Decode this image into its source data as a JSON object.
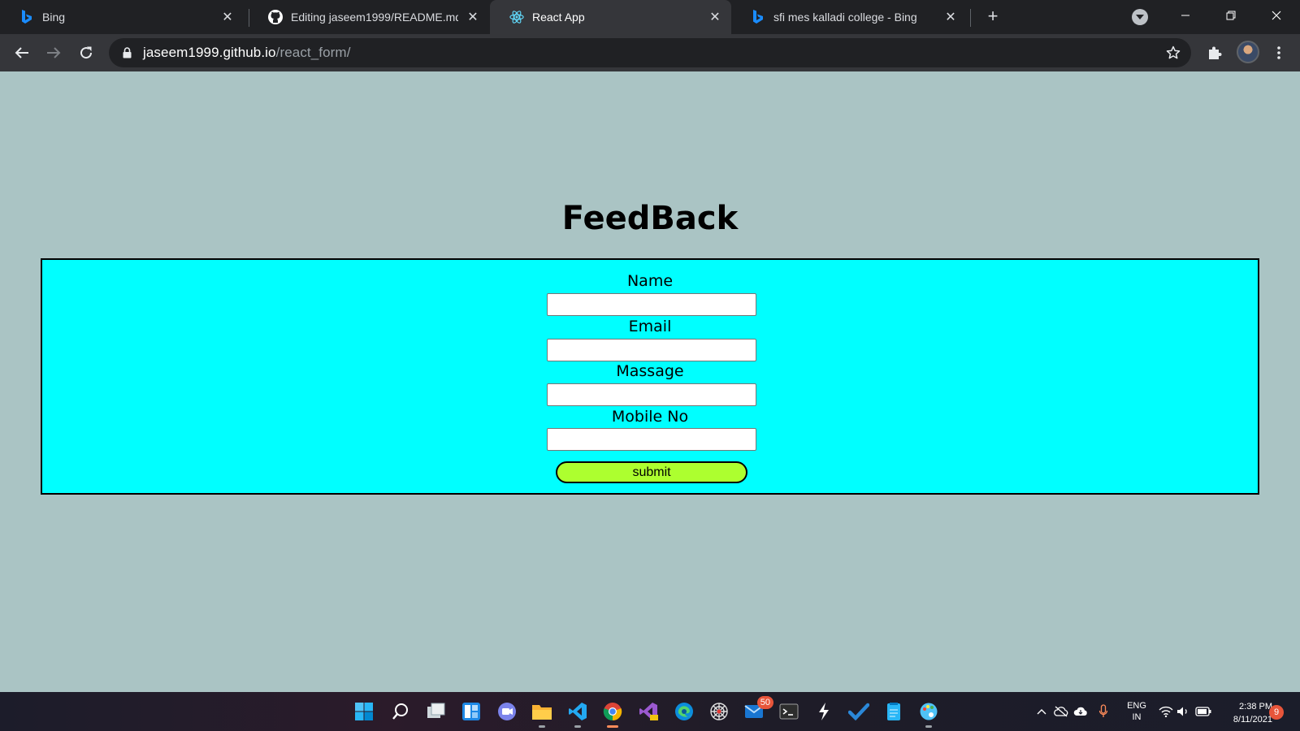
{
  "browser": {
    "tabs": [
      {
        "title": "Bing",
        "favicon": "bing-icon",
        "active": false
      },
      {
        "title": "Editing jaseem1999/README.md at",
        "favicon": "github-icon",
        "active": false
      },
      {
        "title": "React App",
        "favicon": "react-icon",
        "active": true
      },
      {
        "title": "sfi mes kalladi college - Bing",
        "favicon": "bing-icon",
        "active": false
      }
    ],
    "address": {
      "host": "jaseem1999.github.io",
      "path": "/react_form/"
    }
  },
  "page": {
    "title": "FeedBack",
    "background": "#aac4c4",
    "form": {
      "background": "#00ffff",
      "fields": [
        {
          "label": "Name",
          "value": ""
        },
        {
          "label": "Email",
          "value": ""
        },
        {
          "label": "Massage",
          "value": ""
        },
        {
          "label": "Mobile No",
          "value": ""
        }
      ],
      "submit_label": "submit",
      "submit_color": "#adff2f"
    }
  },
  "taskbar": {
    "pinned": [
      "start-icon",
      "search-icon",
      "task-view-icon",
      "widgets-icon",
      "teams-chat-icon",
      "file-explorer-icon",
      "vscode-icon",
      "chrome-icon",
      "visual-studio-icon",
      "edge-icon",
      "spider-app-icon",
      "mail-icon",
      "terminal-icon",
      "bolt-app-icon",
      "todo-icon",
      "notepad-icon",
      "paint-icon"
    ],
    "mail_badge": "50",
    "language": {
      "line1": "ENG",
      "line2": "IN"
    },
    "clock": {
      "time": "2:38 PM",
      "date": "8/11/2021"
    },
    "notification_count": "9"
  }
}
